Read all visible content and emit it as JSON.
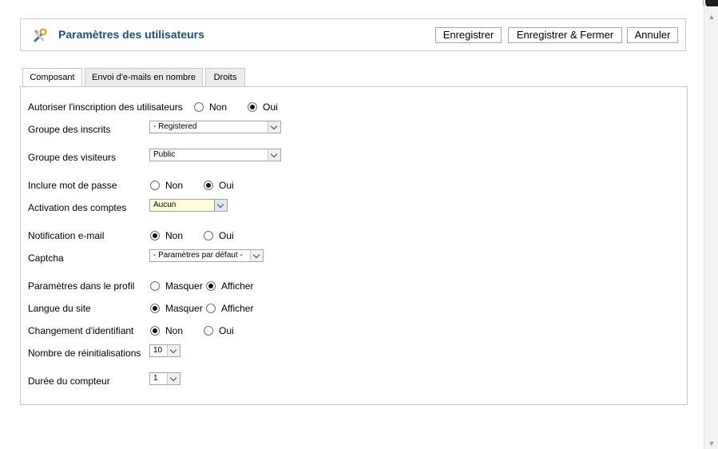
{
  "toolbar": {
    "title": "Paramètres des utilisateurs",
    "icon": "tools-icon",
    "save_label": "Enregistrer",
    "save_close_label": "Enregistrer & Fermer",
    "cancel_label": "Annuler"
  },
  "tabs": [
    {
      "label": "Composant",
      "active": true
    },
    {
      "label": "Envoi d'e-mails en nombre",
      "active": false
    },
    {
      "label": "Droits",
      "active": false
    }
  ],
  "form": {
    "allow_registration": {
      "label": "Autoriser l'inscription des utilisateurs",
      "opt_no": "Non",
      "opt_yes": "Oui",
      "selected": "Oui"
    },
    "new_user_group": {
      "label": "Groupe des inscrits",
      "value": "- Registered"
    },
    "guest_group": {
      "label": "Groupe des visiteurs",
      "value": "Public"
    },
    "send_password": {
      "label": "Inclure mot de passe",
      "opt_no": "Non",
      "opt_yes": "Oui",
      "selected": "Oui"
    },
    "activation": {
      "label": "Activation des comptes",
      "value": "Aucun"
    },
    "mail_notification": {
      "label": "Notification e-mail",
      "opt_no": "Non",
      "opt_yes": "Oui",
      "selected": "Non"
    },
    "captcha": {
      "label": "Captcha",
      "value": "- Paramètres par défaut -"
    },
    "frontend_params": {
      "label": "Paramètres dans le profil",
      "opt_hide": "Masquer",
      "opt_show": "Afficher",
      "selected": "Afficher"
    },
    "site_language": {
      "label": "Langue du site",
      "opt_hide": "Masquer",
      "opt_show": "Afficher",
      "selected": "Masquer"
    },
    "change_login": {
      "label": "Changement d'identifiant",
      "opt_no": "Non",
      "opt_yes": "Oui",
      "selected": "Non"
    },
    "reset_count": {
      "label": "Nombre de réinitialisations",
      "value": "10"
    },
    "reset_time": {
      "label": "Durée du compteur",
      "value": "1"
    }
  }
}
